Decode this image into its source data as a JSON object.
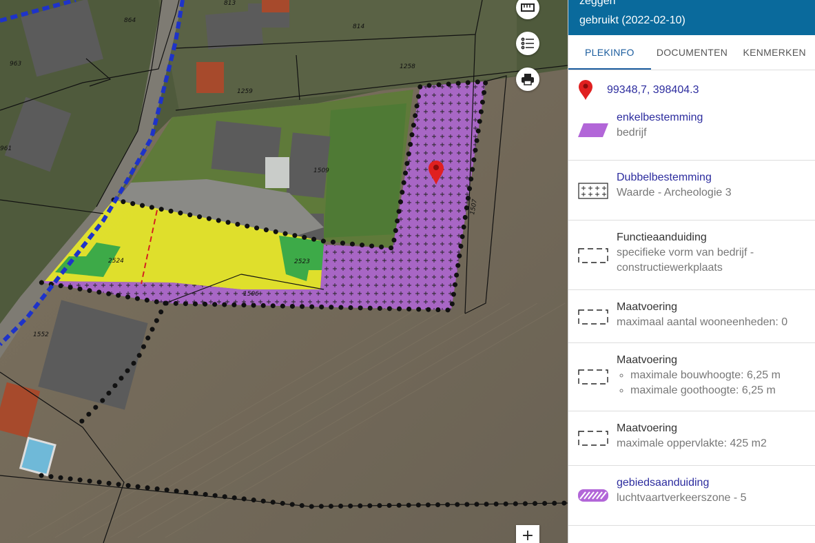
{
  "panel": {
    "header_line1": "zeggen",
    "header_line2": "gebruikt (2022-02-10)",
    "tabs": [
      {
        "label": "PLEKINFO",
        "active": true
      },
      {
        "label": "DOCUMENTEN",
        "active": false
      },
      {
        "label": "KENMERKEN",
        "active": false
      }
    ],
    "coordinates": "99348,7, 398404.3",
    "items": [
      {
        "title": "enkelbestemming",
        "subtitle": "bedrijf",
        "icon": "enkelbestemming-icon"
      },
      {
        "title": "Dubbelbestemming",
        "subtitle": "Waarde - Archeologie 3",
        "icon": "dubbelbestemming-icon"
      },
      {
        "title": "Functieaanduiding",
        "subtitle": "specifieke vorm van bedrijf - constructiewerkplaats",
        "icon": "functieaanduiding-icon"
      },
      {
        "title": "Maatvoering",
        "subtitle": "maximaal aantal wooneenheden: 0",
        "icon": "maatvoering-icon"
      },
      {
        "title": "Maatvoering",
        "bullets": [
          "maximale bouwhoogte: 6,25 m",
          "maximale goothoogte: 6,25 m"
        ],
        "icon": "maatvoering-icon"
      },
      {
        "title": "Maatvoering",
        "subtitle": "maximale oppervlakte: 425 m2",
        "icon": "maatvoering-icon"
      },
      {
        "title": "gebiedsaanduiding",
        "subtitle": "luchtvaartverkeerszone - 5",
        "icon": "gebiedsaanduiding-icon"
      }
    ]
  },
  "map": {
    "parcel_labels": [
      "813",
      "864",
      "814",
      "963",
      "1258",
      "1259",
      "961",
      "1509",
      "1507",
      "2524",
      "2523",
      "1506",
      "1552"
    ],
    "zoom_in_label": "+",
    "colors": {
      "enkelbestemming": "#b266d8",
      "yellow_zone": "#e5e62a",
      "green_zone": "#3daa48",
      "header": "#0a6a9c",
      "link": "#2c2c9e"
    }
  }
}
